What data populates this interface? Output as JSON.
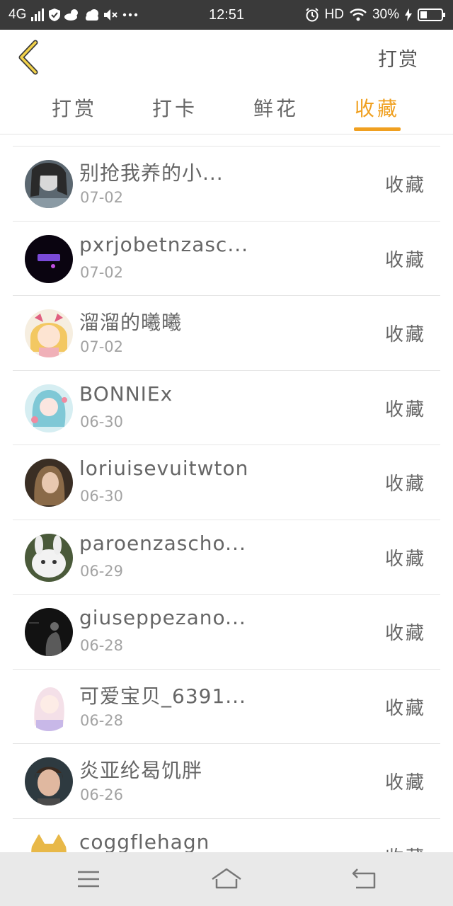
{
  "status_bar": {
    "network": "4G",
    "time": "12:51",
    "hd": "HD",
    "battery": "30%"
  },
  "header": {
    "action_label": "打赏"
  },
  "tabs": [
    {
      "label": "打赏",
      "active": false
    },
    {
      "label": "打卡",
      "active": false
    },
    {
      "label": "鲜花",
      "active": false
    },
    {
      "label": "收藏",
      "active": true
    }
  ],
  "accent_color": "#f0a020",
  "list": [
    {
      "name": "别抢我养的小...",
      "date": "07-02",
      "action": "收藏"
    },
    {
      "name": "pxrjobetnzasc...",
      "date": "07-02",
      "action": "收藏"
    },
    {
      "name": "溜溜的曦曦",
      "date": "07-02",
      "action": "收藏"
    },
    {
      "name": "BONNIEx",
      "date": "06-30",
      "action": "收藏"
    },
    {
      "name": "loriuisevuitwton",
      "date": "06-30",
      "action": "收藏"
    },
    {
      "name": "paroenzascho...",
      "date": "06-29",
      "action": "收藏"
    },
    {
      "name": "giuseppezano...",
      "date": "06-28",
      "action": "收藏"
    },
    {
      "name": "可爱宝贝_6391...",
      "date": "06-28",
      "action": "收藏"
    },
    {
      "name": "炎亚纶曷饥胖",
      "date": "06-26",
      "action": "收藏"
    },
    {
      "name": "coggflehagn",
      "date": "",
      "action": "收藏"
    }
  ]
}
